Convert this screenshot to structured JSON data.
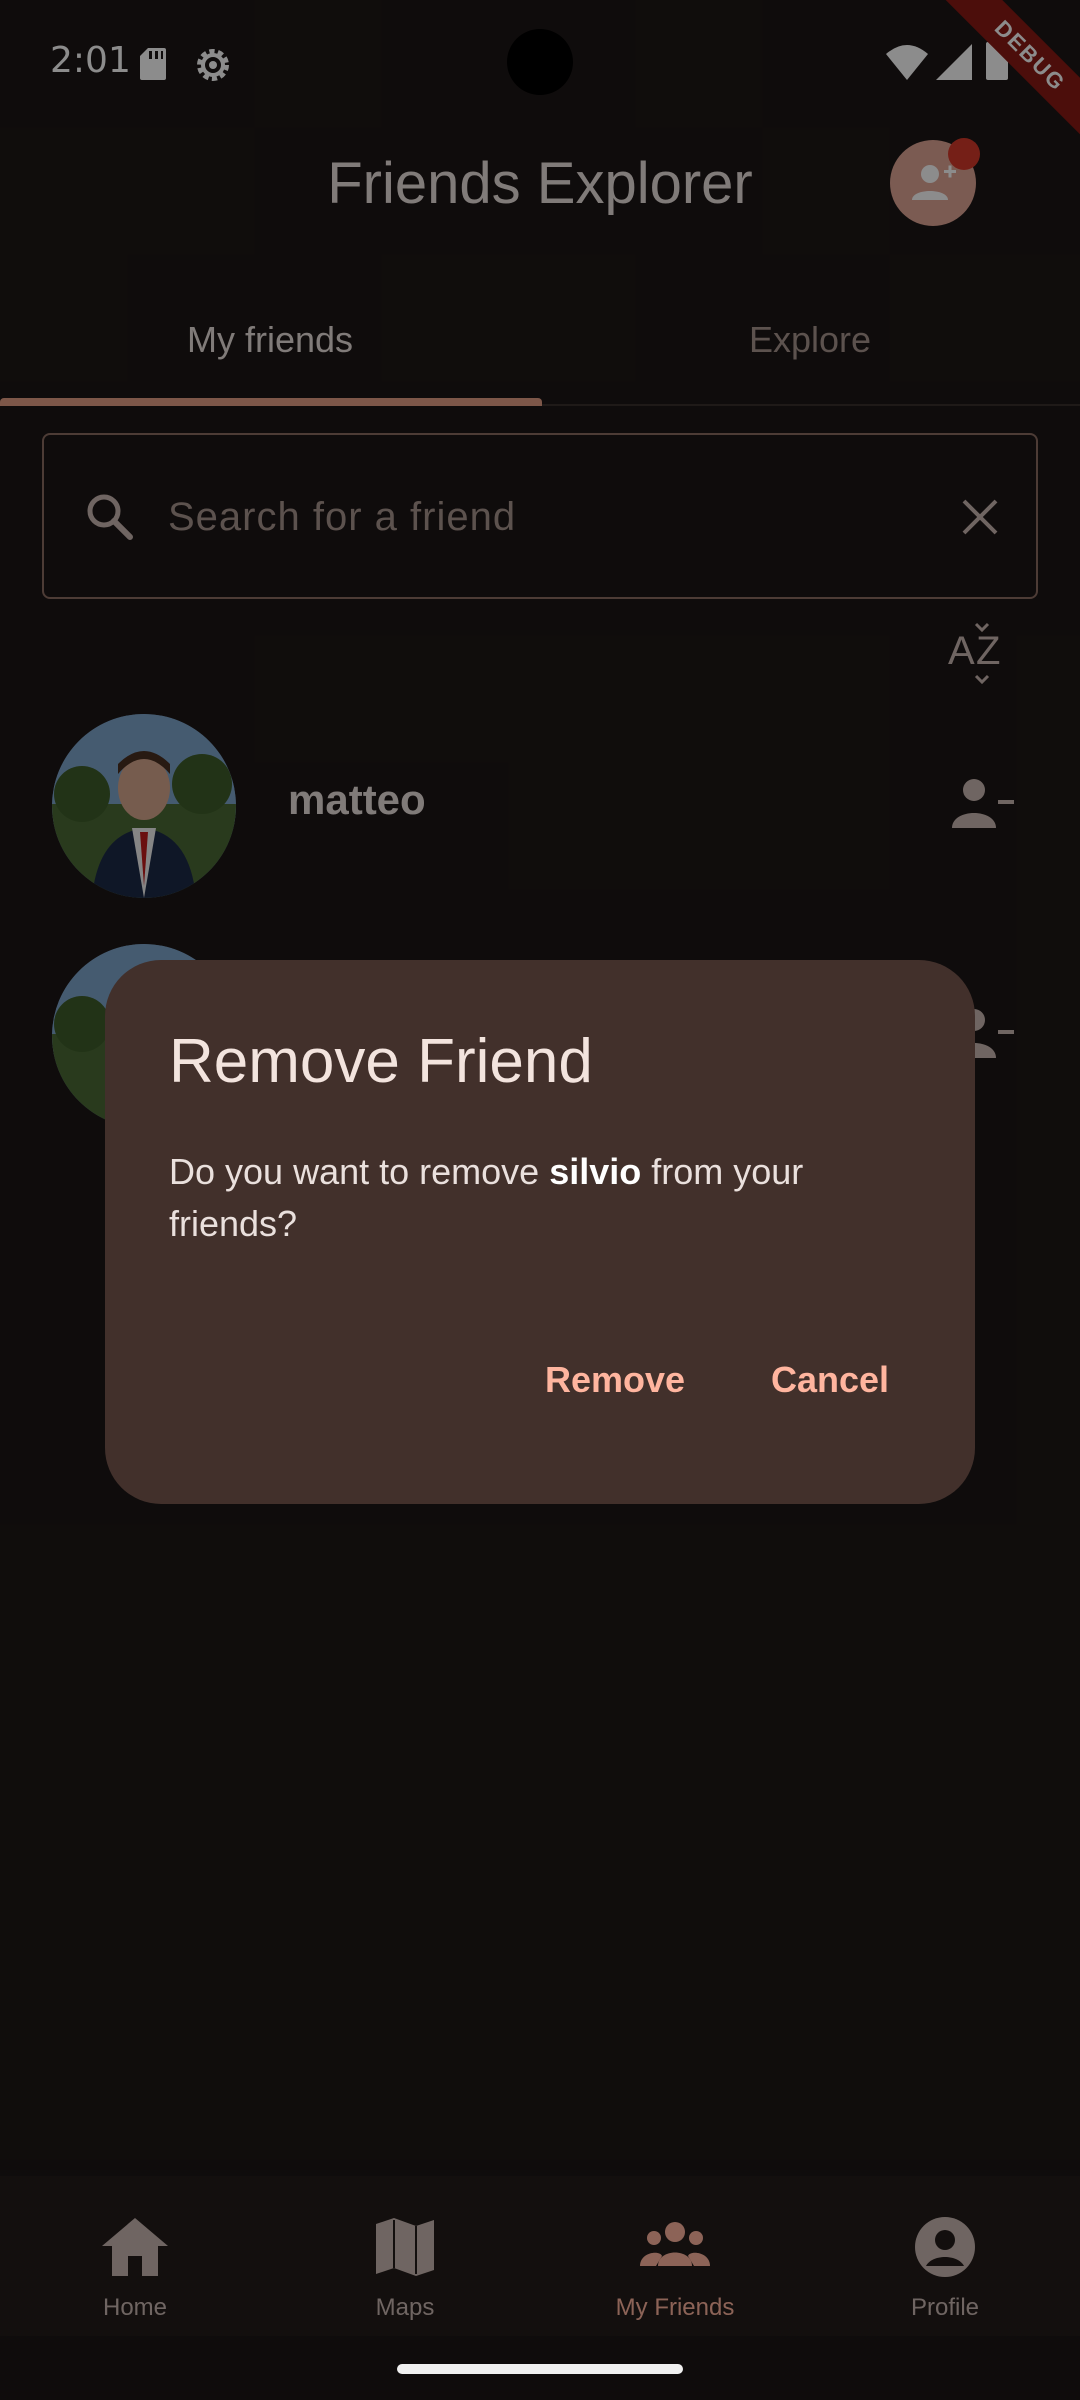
{
  "status_bar": {
    "time": "2:01"
  },
  "debug_banner": "DEBUG",
  "app_bar": {
    "title": "Friends Explorer"
  },
  "tabs": [
    {
      "label": "My friends",
      "selected": true
    },
    {
      "label": "Explore",
      "selected": false
    }
  ],
  "search": {
    "placeholder": "Search for a friend",
    "value": ""
  },
  "friends": [
    {
      "name": "matteo"
    },
    {
      "name": "silvio"
    }
  ],
  "dialog": {
    "title": "Remove Friend",
    "body_prefix": "Do you want to remove ",
    "body_name": "silvio",
    "body_suffix": " from your friends?",
    "remove_label": "Remove",
    "cancel_label": "Cancel"
  },
  "bottom_nav": {
    "items": [
      {
        "label": "Home",
        "icon": "home-icon",
        "selected": false
      },
      {
        "label": "Maps",
        "icon": "map-icon",
        "selected": false
      },
      {
        "label": "My Friends",
        "icon": "group-icon",
        "selected": true
      },
      {
        "label": "Profile",
        "icon": "account-circle-icon",
        "selected": false
      }
    ]
  },
  "colors": {
    "background": "#1d1716",
    "accent": "#ffb59f",
    "dialog": "#42302b",
    "notification": "#d63a2a",
    "debug": "#8b1a14"
  }
}
